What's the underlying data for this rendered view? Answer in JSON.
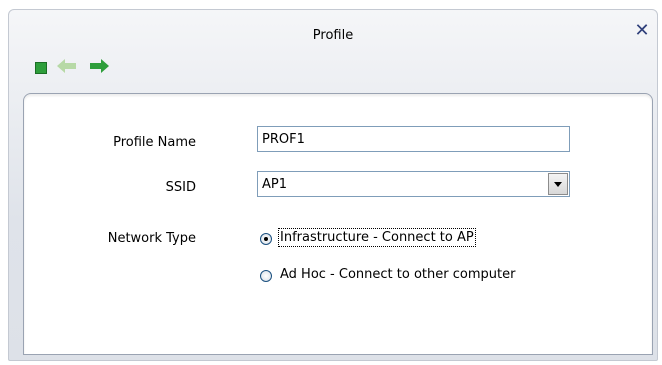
{
  "window": {
    "title": "Profile",
    "close_glyph": "✕"
  },
  "toolbar": {
    "icons": [
      "stop-icon",
      "back-arrow-icon",
      "forward-arrow-icon"
    ],
    "accent": "#2e9e3b"
  },
  "form": {
    "profile_name_label": "Profile Name",
    "profile_name_value": "PROF1",
    "ssid_label": "SSID",
    "ssid_value": "AP1",
    "network_type_label": "Network Type",
    "options": [
      {
        "label": "Infrastructure - Connect to AP",
        "selected": true
      },
      {
        "label": "Ad Hoc - Connect to other computer",
        "selected": false
      }
    ]
  }
}
